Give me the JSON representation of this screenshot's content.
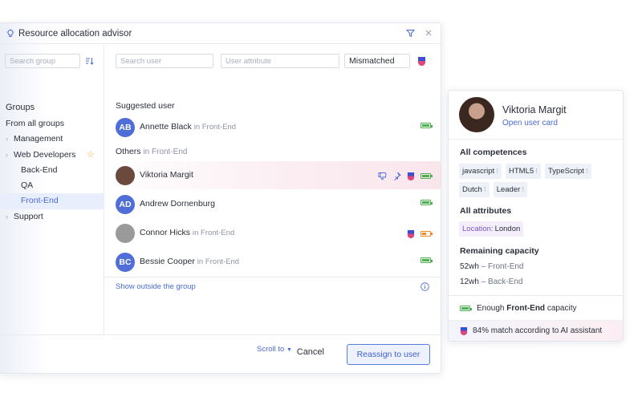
{
  "dialog": {
    "title": "Resource allocation advisor",
    "icons": {
      "title": "lightbulb-icon",
      "filter": "filter-icon",
      "close": "close-icon"
    }
  },
  "left_pane": {
    "search_placeholder": "Search group",
    "groups_heading": "Groups",
    "tree": [
      {
        "label": "From all groups",
        "level": 0
      },
      {
        "label": "Management",
        "level": 1,
        "expandable": true
      },
      {
        "label": "Web Developers",
        "level": 1,
        "expandable": true,
        "starred": true
      },
      {
        "label": "Back-End",
        "level": 2
      },
      {
        "label": "QA",
        "level": 2
      },
      {
        "label": "Front-End",
        "level": 2,
        "selected": true
      },
      {
        "label": "Support",
        "level": 1,
        "expandable": true
      }
    ]
  },
  "filters": {
    "search_user_placeholder": "Search user",
    "user_attribute_placeholder": "User attribute",
    "match_select_value": "Mismatched"
  },
  "suggested": {
    "label": "Suggested user",
    "user": {
      "initials": "AB",
      "name": "Annette Black",
      "group": "in Front-End",
      "capacity": 1.0
    }
  },
  "others": {
    "label": "Others",
    "label_suffix": "in Front-End",
    "users": [
      {
        "name": "Viktoria Margit",
        "group": "",
        "avatar": "photo",
        "highlight": true,
        "capacity": 1.0,
        "icons": [
          "thumbs-down-icon",
          "pin-icon",
          "ai-assistant-icon"
        ]
      },
      {
        "initials": "AD",
        "name": "Andrew Dornenburg",
        "group": "",
        "avatar": "initials",
        "capacity": 1.0,
        "icons": []
      },
      {
        "name": "Connor Hicks",
        "group": "in Front-End",
        "avatar": "photo",
        "capacity": 0.5,
        "icons": [
          "ai-assistant-icon"
        ]
      },
      {
        "initials": "BC",
        "name": "Bessie Cooper",
        "group": "in Front-End",
        "avatar": "initials",
        "capacity": 1.0,
        "icons": []
      }
    ]
  },
  "show_outside": "Show outside the group",
  "scroll_to": "Scroll to",
  "footer": {
    "cancel": "Cancel",
    "reassign": "Reassign to user"
  },
  "user_card": {
    "name": "Viktoria Margit",
    "link": "Open user card",
    "competences_heading": "All competences",
    "competences_row1": [
      "javascript",
      "HTML5",
      "TypeScript"
    ],
    "competences_row2": [
      "Dutch",
      "Leader"
    ],
    "attributes_heading": "All attributes",
    "attribute_key": "Location:",
    "attribute_value": "London",
    "capacity_heading": "Remaining capacity",
    "capacity_lines": [
      {
        "amount": "52wh",
        "group": "– Front-End"
      },
      {
        "amount": "12wh",
        "group": "– Back-End"
      }
    ],
    "status_prefix": "Enough",
    "status_group": "Front-End",
    "status_suffix": "capacity",
    "ai_match": "84% match according to AI assistant"
  },
  "colors": {
    "accent": "#4b6bd6",
    "capacity_ok": "#4caf50",
    "capacity_low": "#f08a2a",
    "selected_bg": "#e8eefc",
    "highlight_row": "#fbeef2"
  }
}
